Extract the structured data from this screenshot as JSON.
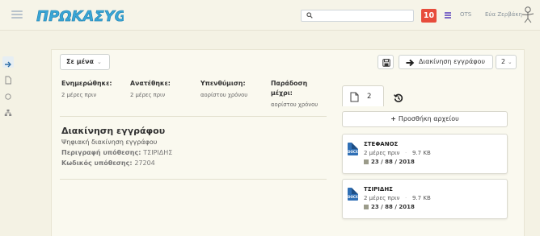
{
  "header": {
    "logo_text": "ΠΡΩΚΑΣΥGΑ",
    "notifications_count": "10",
    "ots_label": "OTS",
    "user_name": "Εύα Ζερβάκη"
  },
  "toolbar": {
    "filter_label": "Σε μένα",
    "move_label": "Διακίνηση εγγράφου",
    "page_count": "2"
  },
  "meta": {
    "updated_label": "Ενημερώθηκε:",
    "updated_value": "2 μέρες πριν",
    "created_label": "Ανατέθηκε:",
    "created_value": "2 μέρες πριν",
    "reminder_label": "Υπενθύμιση:",
    "reminder_value": "αορίστου χρόνου",
    "deadline_label_1": "Παράδοση",
    "deadline_label_2": "μέχρι:",
    "deadline_value": "αορίστου χρόνου"
  },
  "document": {
    "title": "Διακίνηση εγγράφου",
    "subtitle": "Ψηφιακή διακίνηση εγγράφου",
    "description_label": "Περιγραφή υπόθεσης:",
    "description_value": "ΤΣΙΡΙΔΗΣ",
    "case_code_label": "Κωδικός υπόθεσης:",
    "case_code_value": "27204"
  },
  "files_panel": {
    "files_count": "2",
    "add_file_label": "Προσθήκη αρχείου",
    "files": [
      {
        "type": "DOCX",
        "name": "ΣΤΕΦΑΝΟΣ",
        "time": "2 μέρες πριν",
        "size": "9.7 KB",
        "ref": "23 / 88 / 2018"
      },
      {
        "type": "DOCX",
        "name": "ΤΣΙΡΙΔΗΣ",
        "time": "2 μέρες πριν",
        "size": "9.7 KB",
        "ref": "23 / 88 / 2018"
      }
    ]
  },
  "colors": {
    "accent": "#2f9ac8",
    "badge": "#e74c3c",
    "docx": "#2f6fb5"
  }
}
